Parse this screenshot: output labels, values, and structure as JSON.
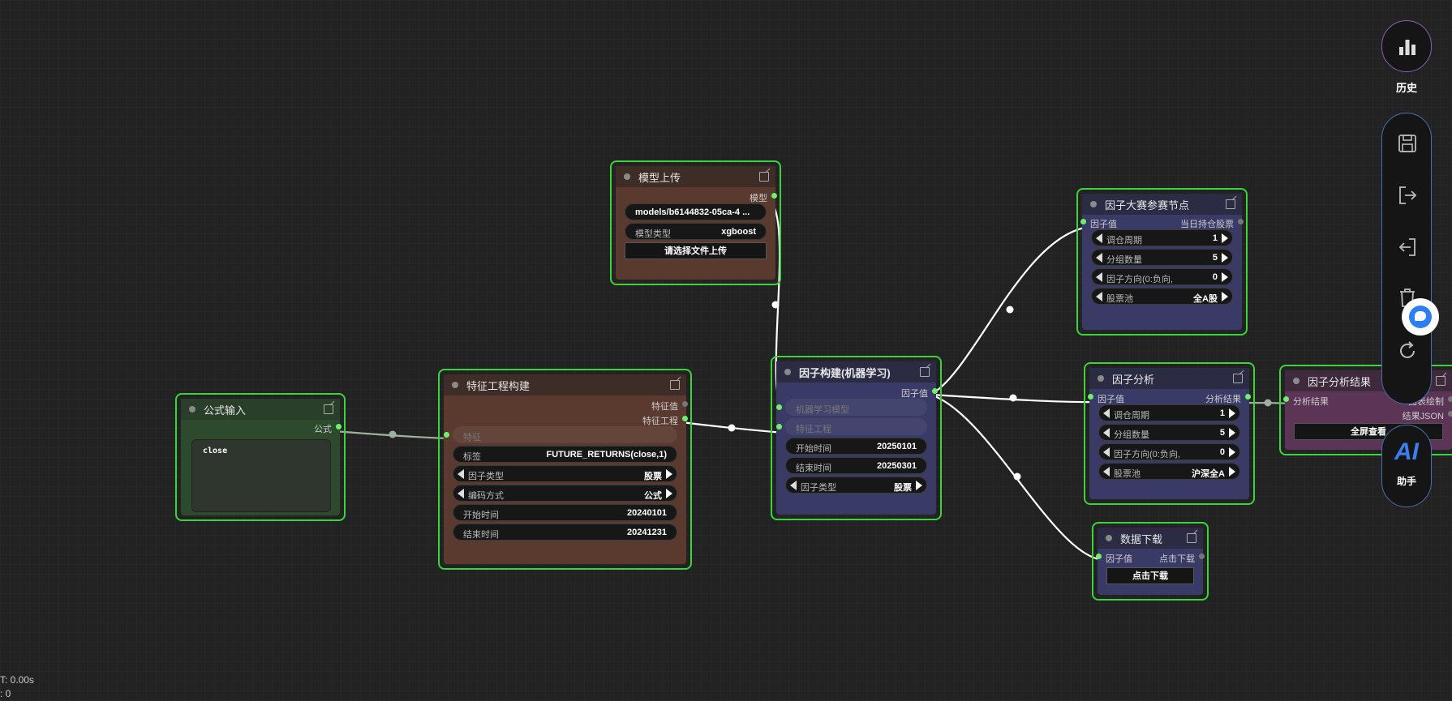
{
  "colors": {
    "accent_green": "#3dd33d",
    "wire": "#ffffff"
  },
  "nodes": {
    "formula_input": {
      "title": "公式输入",
      "output": "公式",
      "text": "close"
    },
    "feature_eng": {
      "title": "特征工程构建",
      "outputs": [
        "特征值",
        "特征工程"
      ],
      "input": "特征",
      "label_name": "标签",
      "label_value": "FUTURE_RETURNS(close,1)",
      "factor_type_label": "因子类型",
      "factor_type_value": "股票",
      "encode_label": "编码方式",
      "encode_value": "公式",
      "start_label": "开始时间",
      "start_value": "20240101",
      "end_label": "结束时间",
      "end_value": "20241231"
    },
    "model_upload": {
      "title": "模型上传",
      "output": "模型",
      "path": "models/b6144832-05ca-4 ...",
      "type_label": "模型类型",
      "type_value": "xgboost",
      "upload_btn": "请选择文件上传"
    },
    "factor_build": {
      "title": "因子构建(机器学习)",
      "output": "因子值",
      "input_model": "机器学习模型",
      "input_feature": "特征工程",
      "start_label": "开始时间",
      "start_value": "20250101",
      "end_label": "结束时间",
      "end_value": "20250301",
      "type_label": "因子类型",
      "type_value": "股票"
    },
    "contest": {
      "title": "因子大赛参赛节点",
      "input": "因子值",
      "output": "当日持仓股票",
      "period_label": "调仓周期",
      "period_value": "1",
      "groups_label": "分组数量",
      "groups_value": "5",
      "direction_label": "因子方向(0:负向,",
      "direction_value": "0",
      "pool_label": "股票池",
      "pool_value": "全A股"
    },
    "analysis": {
      "title": "因子分析",
      "input": "因子值",
      "output": "分析结果",
      "period_label": "调仓周期",
      "period_value": "1",
      "groups_label": "分组数量",
      "groups_value": "5",
      "direction_label": "因子方向(0:负向,",
      "direction_value": "0",
      "pool_label": "股票池",
      "pool_value": "沪深全A"
    },
    "result": {
      "title": "因子分析结果",
      "input": "分析结果",
      "out1": "图表绘制",
      "out2": "结果JSON",
      "btn": "全屏查看"
    },
    "download": {
      "title": "数据下载",
      "input": "因子值",
      "output": "点击下载",
      "btn": "点击下载"
    }
  },
  "sidebar": {
    "history_label": "历史",
    "ai_glyph": "AI",
    "ai_label": "助手",
    "icons": [
      "bar-chart-icon",
      "save-icon",
      "export-icon",
      "import-icon",
      "trash-icon",
      "refresh-icon",
      "chat-bubble-icon"
    ]
  },
  "stats": {
    "line1": "T: 0.00s",
    "line2": ": 0"
  }
}
